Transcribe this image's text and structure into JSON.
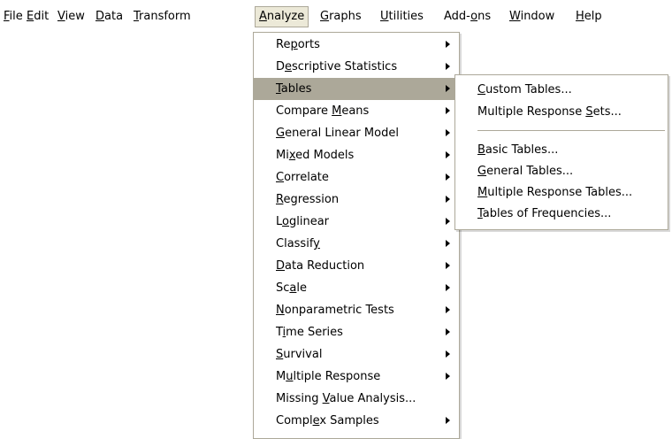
{
  "menubar": [
    {
      "pre": "",
      "u": "F",
      "post": "ile"
    },
    {
      "pre": "",
      "u": "E",
      "post": "dit"
    },
    {
      "pre": "",
      "u": "V",
      "post": "iew"
    },
    {
      "pre": "",
      "u": "D",
      "post": "ata"
    },
    {
      "pre": "",
      "u": "T",
      "post": "ransform"
    },
    {
      "pre": "",
      "u": "A",
      "post": "nalyze"
    },
    {
      "pre": "",
      "u": "G",
      "post": "raphs"
    },
    {
      "pre": "",
      "u": "U",
      "post": "tilities"
    },
    {
      "pre": "Add-",
      "u": "o",
      "post": "ns"
    },
    {
      "pre": "",
      "u": "W",
      "post": "indow"
    },
    {
      "pre": "",
      "u": "H",
      "post": "elp"
    }
  ],
  "analyze_menu": [
    {
      "pre": "Re",
      "u": "p",
      "post": "orts"
    },
    {
      "pre": "D",
      "u": "e",
      "post": "scriptive Statistics"
    },
    {
      "pre": "",
      "u": "T",
      "post": "ables"
    },
    {
      "pre": "Compare ",
      "u": "M",
      "post": "eans"
    },
    {
      "pre": "",
      "u": "G",
      "post": "eneral Linear Model"
    },
    {
      "pre": "Mi",
      "u": "x",
      "post": "ed Models"
    },
    {
      "pre": "",
      "u": "C",
      "post": "orrelate"
    },
    {
      "pre": "",
      "u": "R",
      "post": "egression"
    },
    {
      "pre": "L",
      "u": "o",
      "post": "glinear"
    },
    {
      "pre": "Classif",
      "u": "y",
      "post": ""
    },
    {
      "pre": "",
      "u": "D",
      "post": "ata Reduction"
    },
    {
      "pre": "Sc",
      "u": "a",
      "post": "le"
    },
    {
      "pre": "",
      "u": "N",
      "post": "onparametric Tests"
    },
    {
      "pre": "T",
      "u": "i",
      "post": "me Series"
    },
    {
      "pre": "",
      "u": "S",
      "post": "urvival"
    },
    {
      "pre": "M",
      "u": "u",
      "post": "ltiple Response"
    },
    {
      "pre": "Missing ",
      "u": "V",
      "post": "alue Analysis..."
    },
    {
      "pre": "Compl",
      "u": "e",
      "post": "x Samples"
    }
  ],
  "tables_submenu": [
    {
      "pre": "",
      "u": "C",
      "post": "ustom Tables..."
    },
    {
      "pre": "Multiple Response ",
      "u": "S",
      "post": "ets..."
    },
    {
      "pre": "",
      "u": "B",
      "post": "asic Tables..."
    },
    {
      "pre": "",
      "u": "G",
      "post": "eneral Tables..."
    },
    {
      "pre": "",
      "u": "M",
      "post": "ultiple Response Tables..."
    },
    {
      "pre": "",
      "u": "T",
      "post": "ables of Frequencies..."
    }
  ]
}
